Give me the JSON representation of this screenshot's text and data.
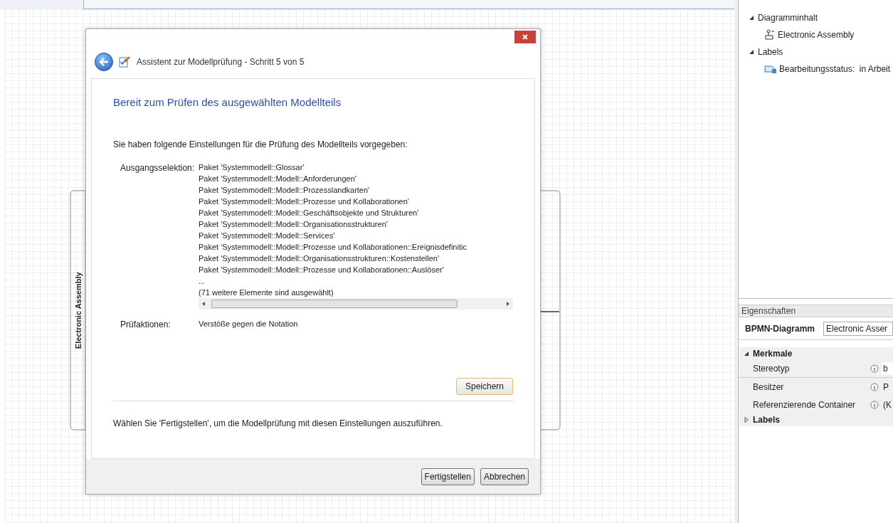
{
  "canvas": {
    "pool": {
      "label": "Electronic Assembly"
    }
  },
  "dialog": {
    "title": "Assistent zur Modellprüfung - Schritt 5 von 5",
    "heading": "Bereit zum Prüfen des ausgewählten Modellteils",
    "intro": "Sie haben folgende Einstellungen für die Prüfung des Modellteils vorgegeben:",
    "summary": [
      {
        "label": "Ausgangsselektion:",
        "scrollable": true,
        "values": [
          "Paket 'Systemmodell::Glossar'",
          "Paket 'Systemmodell::Modell::Anforderungen'",
          "Paket 'Systemmodell::Modell::Prozesslandkarten'",
          "Paket 'Systemmodell::Modell::Prozesse und Kollaborationen'",
          "Paket 'Systemmodell::Modell::Geschäftsobjekte und Strukturen'",
          "Paket 'Systemmodell::Modell::Organisationsstrukturen'",
          "Paket 'Systemmodell::Modell::Services'",
          "Paket 'Systemmodell::Modell::Prozesse und Kollaborationen::Ereignisdefinitic",
          "Paket 'Systemmodell::Modell::Organisationsstrukturen::Kostenstellen'",
          "Paket 'Systemmodell::Modell::Prozesse und Kollaborationen::Auslöser'",
          "...",
          "(71 weitere Elemente sind ausgewählt)"
        ]
      },
      {
        "label": "Prüfaktionen:",
        "scrollable": false,
        "values": [
          "Verstöße gegen die Notation"
        ]
      }
    ],
    "save_button": "Speichern",
    "footer_text": "Wählen Sie 'Fertigstellen', um die Modellprüfung mit diesen Einstellungen auszuführen.",
    "buttons": [
      "Fertigstellen",
      "Abbrechen"
    ]
  },
  "outline": {
    "items": [
      {
        "label": "Diagramminhalt",
        "expanded": true,
        "children": [
          {
            "label": "Electronic Assembly",
            "kind": "element"
          }
        ]
      },
      {
        "label": "Labels",
        "expanded": true,
        "children": [
          {
            "label": "Bearbeitungsstatus:  in Arbeit",
            "kind": "label"
          }
        ]
      }
    ]
  },
  "properties": {
    "title": "Eigenschaften",
    "type": "BPMN-Diagramm",
    "name_value": "Electronic Asser",
    "groups": [
      {
        "label": "Merkmale",
        "expanded": true,
        "rows": [
          {
            "label": "Stereotyp",
            "value": "b"
          },
          {
            "label": "Besitzer",
            "value": "P"
          },
          {
            "label": "Referenzierende Container",
            "value": "(K"
          }
        ]
      },
      {
        "label": "Labels",
        "expanded": false
      }
    ]
  }
}
